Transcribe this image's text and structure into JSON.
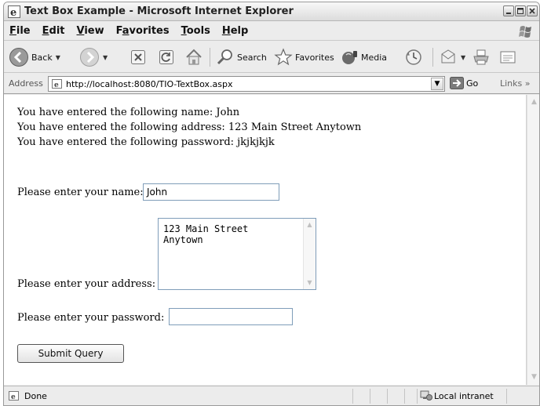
{
  "window": {
    "title": "Text Box Example - Microsoft Internet Explorer"
  },
  "menu": {
    "items": [
      {
        "accel": "F",
        "rest": "ile"
      },
      {
        "accel": "E",
        "rest": "dit"
      },
      {
        "accel": "V",
        "rest": "iew"
      },
      {
        "pre": "F",
        "accel": "a",
        "rest": "vorites"
      },
      {
        "accel": "T",
        "rest": "ools"
      },
      {
        "accel": "H",
        "rest": "elp"
      }
    ]
  },
  "toolbar": {
    "back_label": "Back",
    "search_label": "Search",
    "favorites_label": "Favorites",
    "media_label": "Media"
  },
  "address": {
    "label": "Address",
    "url": "http://localhost:8080/TIO-TextBox.aspx",
    "go_label": "Go",
    "links_label": "Links"
  },
  "page": {
    "line_name": "You have entered the following name: John",
    "line_address": "You have entered the following address: 123 Main Street Anytown",
    "line_password": "You have entered the following password: jkjkjkjk",
    "name_label": "Please enter your name:",
    "name_value": "John",
    "address_label": "Please enter your address:",
    "address_value": "123 Main Street\nAnytown",
    "password_label": "Please enter your password:",
    "password_value": "",
    "submit_label": "Submit Query"
  },
  "status": {
    "text": "Done",
    "zone": "Local intranet"
  }
}
